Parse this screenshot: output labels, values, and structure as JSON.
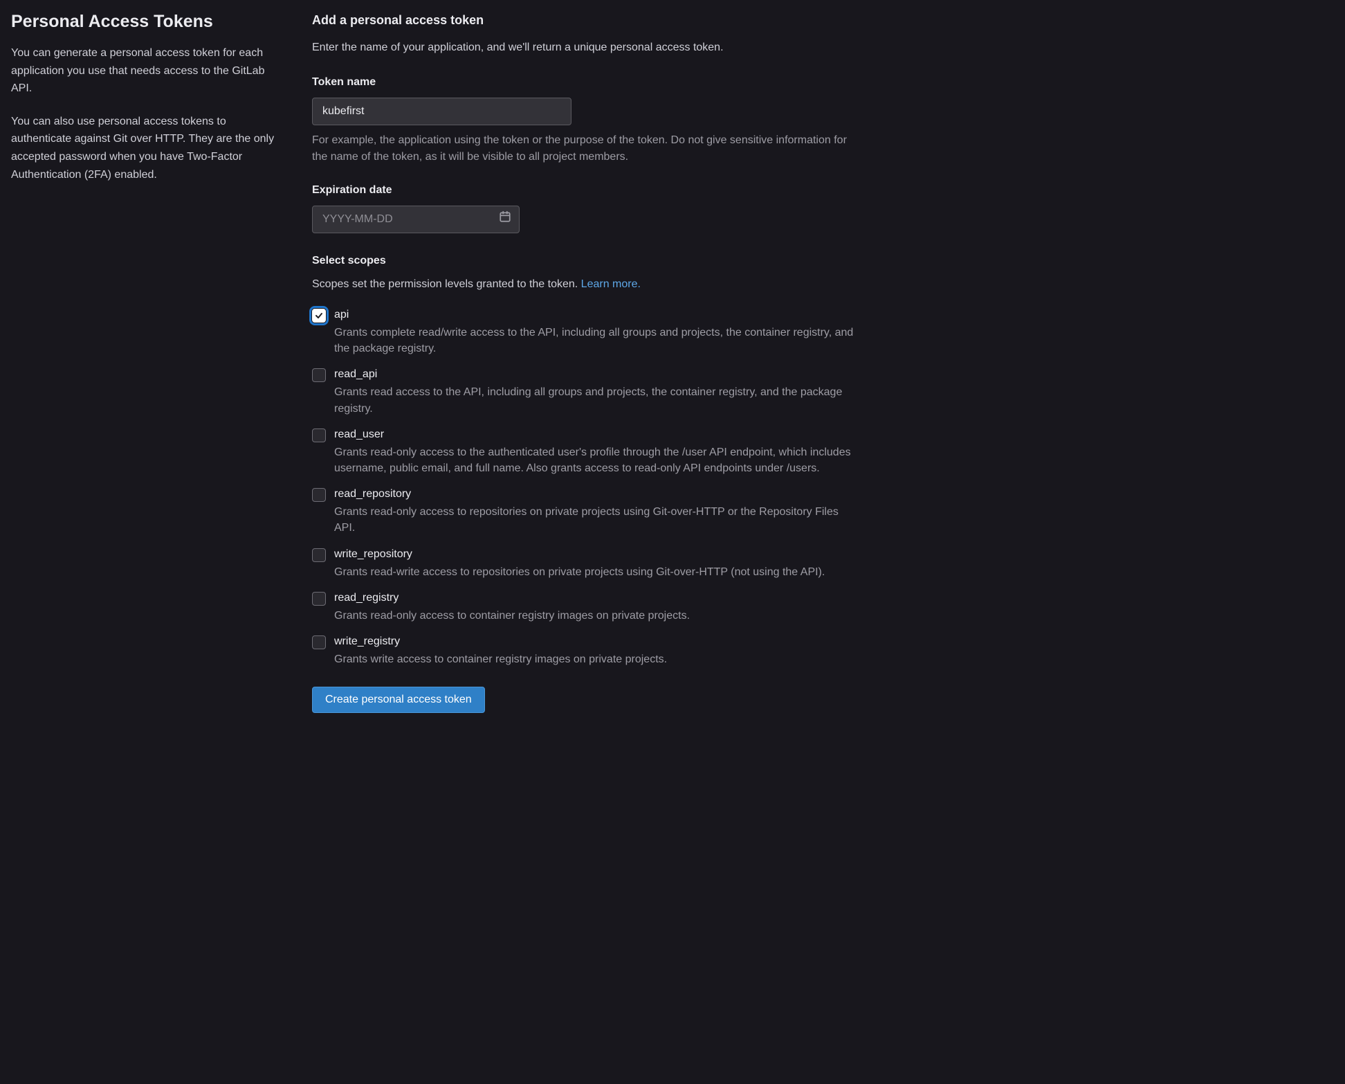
{
  "sidebar": {
    "title": "Personal Access Tokens",
    "para1": "You can generate a personal access token for each application you use that needs access to the GitLab API.",
    "para2": "You can also use personal access tokens to authenticate against Git over HTTP. They are the only accepted password when you have Two-Factor Authentication (2FA) enabled."
  },
  "form": {
    "heading": "Add a personal access token",
    "intro": "Enter the name of your application, and we'll return a unique personal access token.",
    "name_label": "Token name",
    "name_value": "kubefirst",
    "name_help": "For example, the application using the token or the purpose of the token. Do not give sensitive information for the name of the token, as it will be visible to all project members.",
    "exp_label": "Expiration date",
    "exp_placeholder": "YYYY-MM-DD",
    "exp_value": "",
    "scopes_label": "Select scopes",
    "scopes_desc_prefix": "Scopes set the permission levels granted to the token. ",
    "learn_more": "Learn more.",
    "submit": "Create personal access token"
  },
  "scopes": [
    {
      "key": "api",
      "checked": true,
      "label": "api",
      "desc": "Grants complete read/write access to the API, including all groups and projects, the container registry, and the package registry."
    },
    {
      "key": "read_api",
      "checked": false,
      "label": "read_api",
      "desc": "Grants read access to the API, including all groups and projects, the container registry, and the package registry."
    },
    {
      "key": "read_user",
      "checked": false,
      "label": "read_user",
      "desc": "Grants read-only access to the authenticated user's profile through the /user API endpoint, which includes username, public email, and full name. Also grants access to read-only API endpoints under /users."
    },
    {
      "key": "read_repository",
      "checked": false,
      "label": "read_repository",
      "desc": "Grants read-only access to repositories on private projects using Git-over-HTTP or the Repository Files API."
    },
    {
      "key": "write_repository",
      "checked": false,
      "label": "write_repository",
      "desc": "Grants read-write access to repositories on private projects using Git-over-HTTP (not using the API)."
    },
    {
      "key": "read_registry",
      "checked": false,
      "label": "read_registry",
      "desc": "Grants read-only access to container registry images on private projects."
    },
    {
      "key": "write_registry",
      "checked": false,
      "label": "write_registry",
      "desc": "Grants write access to container registry images on private projects."
    }
  ]
}
